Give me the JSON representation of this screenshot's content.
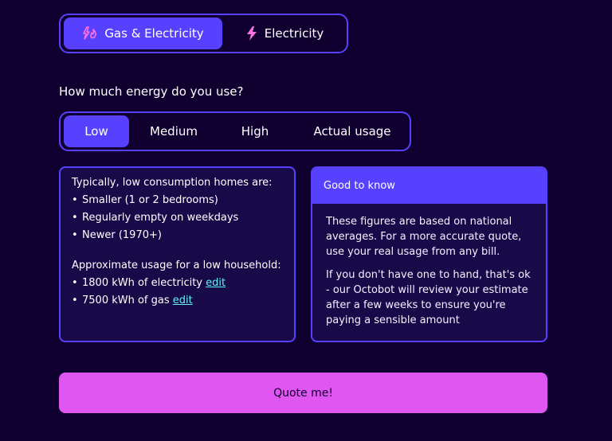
{
  "fuel_toggle": {
    "options": [
      {
        "label": "Gas & Electricity",
        "icon": "gas-electricity-icon",
        "selected": true
      },
      {
        "label": "Electricity",
        "icon": "lightning-icon",
        "selected": false
      }
    ]
  },
  "usage": {
    "question": "How much energy do you use?",
    "options": [
      {
        "label": "Low",
        "selected": true
      },
      {
        "label": "Medium",
        "selected": false
      },
      {
        "label": "High",
        "selected": false
      },
      {
        "label": "Actual usage",
        "selected": false
      }
    ]
  },
  "info_card": {
    "heading": "Typically, low consumption homes are:",
    "traits": [
      "Smaller (1 or 2 bedrooms)",
      "Regularly empty on weekdays",
      "Newer (1970+)"
    ],
    "usage_heading": "Approximate usage for a low household:",
    "usage_items": [
      {
        "text": "1800 kWh of electricity ",
        "link": "edit"
      },
      {
        "text": "7500 kWh of gas ",
        "link": "edit"
      }
    ]
  },
  "good_to_know": {
    "title": "Good to know",
    "paragraphs": [
      "These figures are based on national averages. For a more accurate quote, use your real usage from any bill.",
      "If you don't have one to hand, that's ok - our Octobot will review your estimate after a few weeks to ensure you're paying a sensible amount"
    ]
  },
  "quote_button": {
    "label": "Quote me!"
  },
  "colors": {
    "background": "#100030",
    "accent": "#5840ff",
    "card": "#180a48",
    "button": "#e056f0",
    "link": "#60f0f8",
    "icon": "#ff70e0"
  }
}
